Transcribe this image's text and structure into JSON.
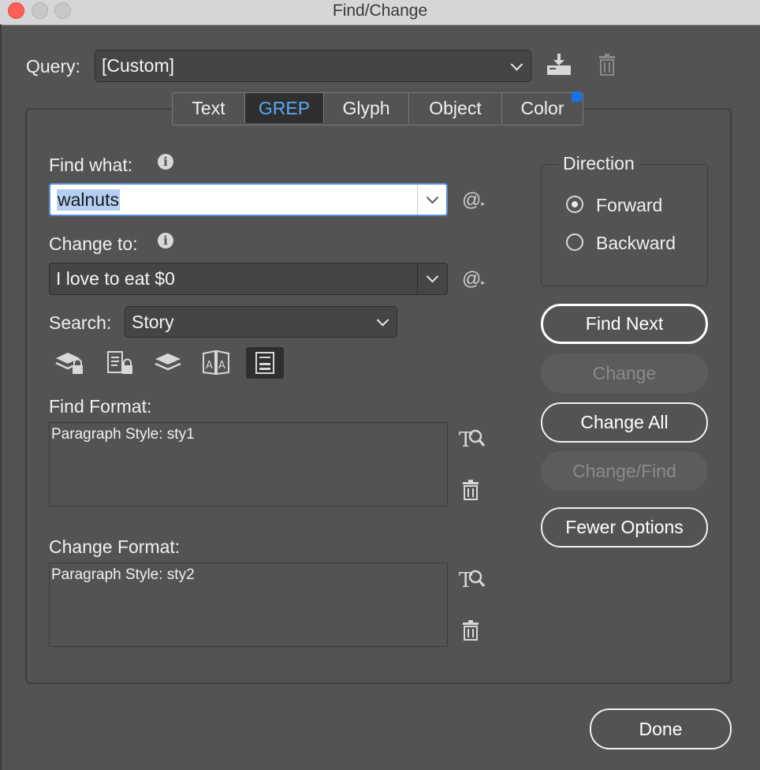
{
  "window": {
    "title": "Find/Change"
  },
  "query": {
    "label": "Query:",
    "value": "[Custom]"
  },
  "tabs": [
    {
      "label": "Text",
      "active": false
    },
    {
      "label": "GREP",
      "active": true
    },
    {
      "label": "Glyph",
      "active": false
    },
    {
      "label": "Object",
      "active": false
    },
    {
      "label": "Color",
      "active": false
    }
  ],
  "find": {
    "label": "Find what:",
    "value": "walnuts",
    "special_chars": "@"
  },
  "change": {
    "label": "Change to:",
    "value": "I love to eat $0",
    "special_chars": "@"
  },
  "search": {
    "label": "Search:",
    "value": "Story"
  },
  "find_format": {
    "label": "Find Format:",
    "value": "Paragraph Style: sty1"
  },
  "change_format": {
    "label": "Change Format:",
    "value": "Paragraph Style: sty2"
  },
  "direction": {
    "legend": "Direction",
    "options": [
      {
        "label": "Forward",
        "selected": true
      },
      {
        "label": "Backward",
        "selected": false
      }
    ]
  },
  "buttons": {
    "find_next": "Find Next",
    "change": "Change",
    "change_all": "Change All",
    "change_find": "Change/Find",
    "fewer_options": "Fewer Options",
    "done": "Done"
  },
  "colors": {
    "accent": "#5aa9f5",
    "marker": "#1a73e8",
    "background": "#535353"
  }
}
